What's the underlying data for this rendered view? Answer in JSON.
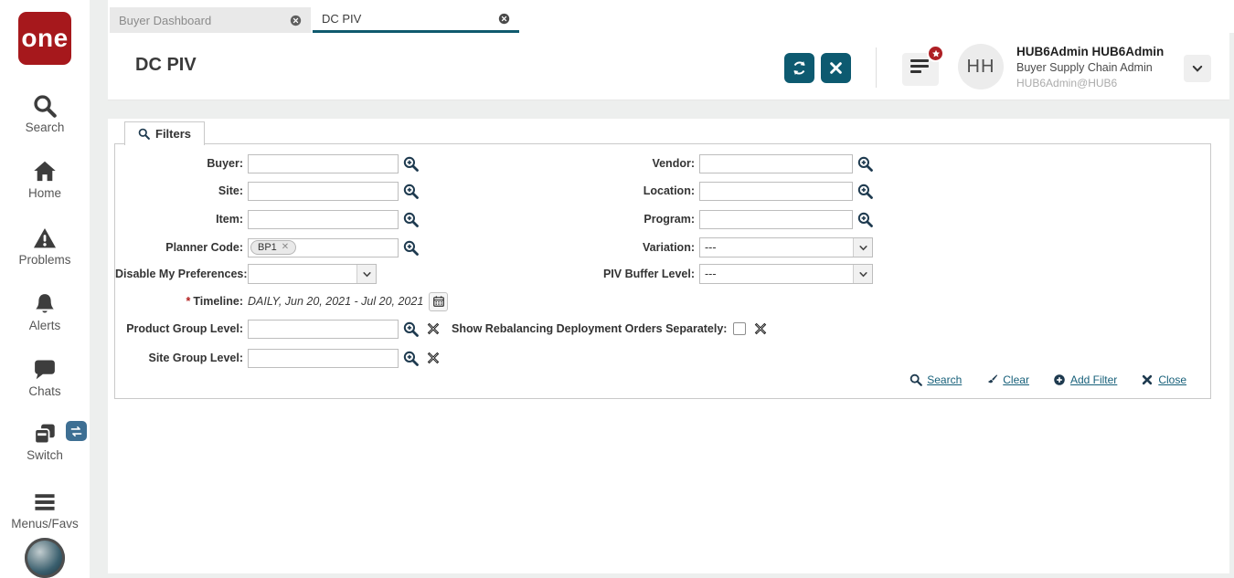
{
  "colors": {
    "accent_teal": "#0d5a70",
    "logo_red": "#a6181c",
    "badge_red": "#ae1f24",
    "icon_navy": "#1e3a4f",
    "link_teal": "#17607a"
  },
  "logo": {
    "text": "one"
  },
  "sidebar": {
    "items": [
      {
        "icon": "search-icon",
        "label": "Search"
      },
      {
        "icon": "home-icon",
        "label": "Home"
      },
      {
        "icon": "warning-triangle-icon",
        "label": "Problems"
      },
      {
        "icon": "bell-icon",
        "label": "Alerts"
      },
      {
        "icon": "chat-bubble-icon",
        "label": "Chats"
      },
      {
        "icon": "stacked-windows-icon",
        "label": "Switch"
      },
      {
        "icon": "hamburger-icon",
        "label": "Menus/Favs"
      }
    ]
  },
  "tabs": {
    "items": [
      {
        "label": "Buyer Dashboard",
        "active": false
      },
      {
        "label": "DC PIV",
        "active": true
      }
    ]
  },
  "header": {
    "title": "DC PIV",
    "user": {
      "initials": "HH",
      "name": "HUB6Admin HUB6Admin",
      "role": "Buyer Supply Chain Admin",
      "org": "HUB6Admin@HUB6"
    }
  },
  "filters": {
    "tab_label": "Filters",
    "fields": {
      "buyer": {
        "label": "Buyer:",
        "value": ""
      },
      "site": {
        "label": "Site:",
        "value": ""
      },
      "item": {
        "label": "Item:",
        "value": ""
      },
      "planner_code": {
        "label": "Planner Code:",
        "chip": "BP1"
      },
      "disable_my_preferences": {
        "label": "Disable My Preferences:",
        "value": ""
      },
      "timeline": {
        "required_mark": "*",
        "label": "Timeline:",
        "value": "DAILY, Jun 20, 2021 - Jul 20, 2021"
      },
      "product_group_level": {
        "label": "Product Group Level:",
        "value": ""
      },
      "site_group_level": {
        "label": "Site Group Level:",
        "value": ""
      },
      "vendor": {
        "label": "Vendor:",
        "value": ""
      },
      "location": {
        "label": "Location:",
        "value": ""
      },
      "program": {
        "label": "Program:",
        "value": ""
      },
      "variation": {
        "label": "Variation:",
        "value": "---"
      },
      "piv_buffer_level": {
        "label": "PIV Buffer Level:",
        "value": "---"
      },
      "show_rebalancing": {
        "label": "Show Rebalancing Deployment Orders Separately:",
        "checked": false
      }
    },
    "actions": {
      "search": "Search",
      "clear": "Clear",
      "add_filter": "Add Filter",
      "close": "Close"
    }
  }
}
